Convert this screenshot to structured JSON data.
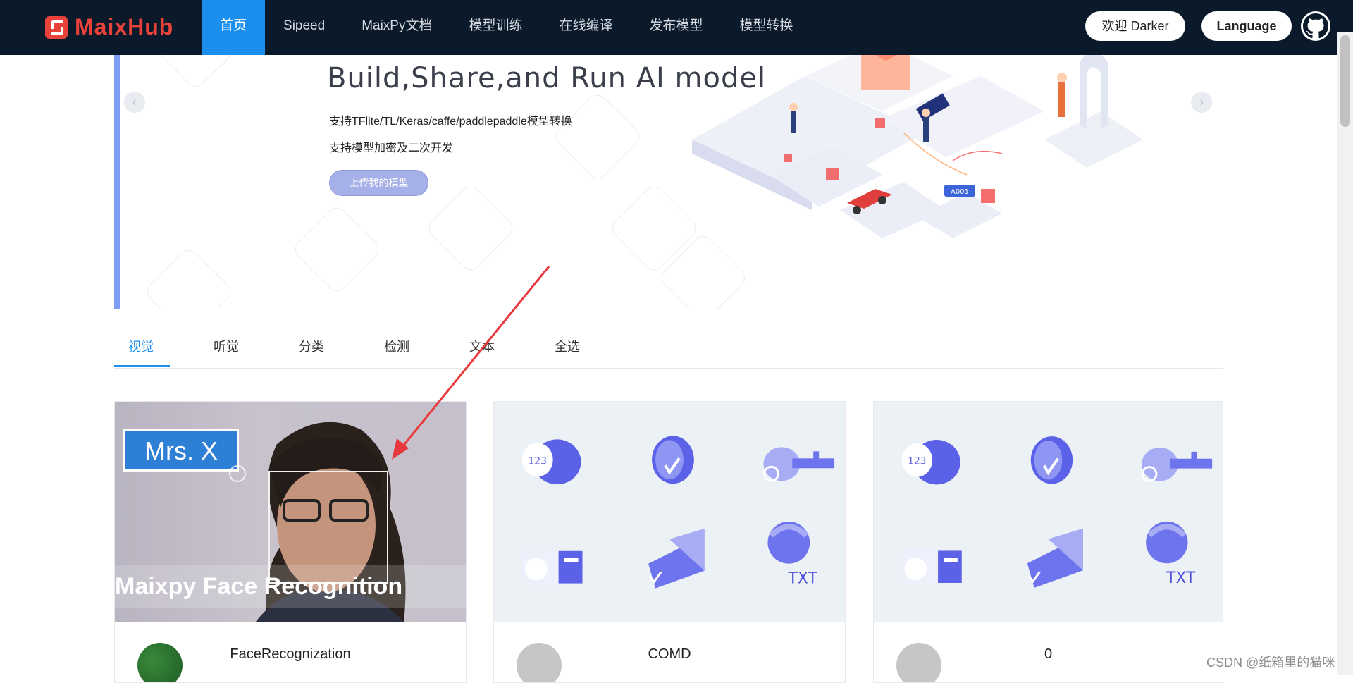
{
  "nav": {
    "logo_text": "MaixHub",
    "menu": [
      {
        "label": "首页",
        "active": true
      },
      {
        "label": "Sipeed"
      },
      {
        "label": "MaixPy文档"
      },
      {
        "label": "模型训练"
      },
      {
        "label": "在线编译"
      },
      {
        "label": "发布模型"
      },
      {
        "label": "模型转换"
      }
    ],
    "welcome": "欢迎 Darker",
    "language": "Language",
    "github_icon": "github-icon"
  },
  "banner": {
    "title": "Build,Share,and Run AI model",
    "line1": "支持TFlite/TL/Keras/caffe/paddlepaddle模型转换",
    "line2": "支持模型加密及二次开发",
    "button": "上传我的模型",
    "badge": "A001",
    "button_color": "#a6b0e8"
  },
  "tabs": [
    {
      "label": "视觉",
      "active": true
    },
    {
      "label": "听觉"
    },
    {
      "label": "分类"
    },
    {
      "label": "检测"
    },
    {
      "label": "文本"
    },
    {
      "label": "全选"
    }
  ],
  "cards": [
    {
      "title": "FaceRecognization",
      "image_label": "Mrs. X",
      "image_caption": "Maixpy Face Recognition"
    },
    {
      "title": "COMD"
    },
    {
      "title": "0"
    }
  ],
  "watermark": "CSDN @纸箱里的猫咪",
  "colors": {
    "nav_bg": "#0b1a2b",
    "accent": "#1b8ff0",
    "arrow": "#e8383b",
    "logo": "#e8423b"
  }
}
